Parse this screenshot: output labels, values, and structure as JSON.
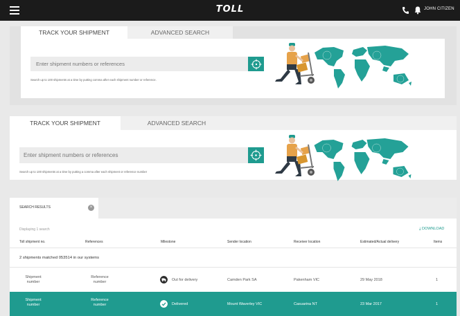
{
  "header": {
    "logo": "TOLL",
    "user_name": "JOHN CITIZEN"
  },
  "search_panel_1": {
    "tabs": [
      "TRACK YOUR SHIPMENT",
      "ADVANCED SEARCH"
    ],
    "placeholder": "Enter shipment numbers or references",
    "help": "Search up to 100 shipments at a time by putting comma after each shipment number or reference."
  },
  "search_panel_2": {
    "tabs": [
      "TRACK YOUR SHIPMENT",
      "ADVANCED SEARCH"
    ],
    "placeholder": "Enter shipment numbers or references",
    "help": "Search up to 100 shipments at a time by putting a comma after each shipment or reference number"
  },
  "results": {
    "tab_label": "SEARCH RESULTS",
    "close_glyph": "×",
    "display_count": "Displaying 1 search",
    "download": "⤓ DOWNLOAD",
    "columns": [
      "Toll shipment no.",
      "References",
      "Milestone",
      "Sender location",
      "Receiver location",
      "Estimated/Actual delivery",
      "Items"
    ],
    "matched_text": "2 shipments matched 053514 in our systems",
    "rows": [
      {
        "shipment": [
          "Shipment",
          "number"
        ],
        "reference": [
          "Reference",
          "number"
        ],
        "milestone": "Out for delivery",
        "sender": "Camden Park SA",
        "receiver": "Pakenham VIC",
        "delivery": "29 May 2018",
        "items": "1"
      },
      {
        "shipment": [
          "Shipment",
          "number"
        ],
        "reference": [
          "Reference",
          "number"
        ],
        "milestone": "Delivered",
        "sender": "Mount Waverley VIC",
        "receiver": "Casuarina NT",
        "delivery": "23 Mar 2017",
        "items": "1"
      }
    ]
  },
  "colors": {
    "teal": "#1f9b8f",
    "topbar": "#1b1b1b",
    "map": "#24a197",
    "worker_shirt": "#e6a24a"
  }
}
